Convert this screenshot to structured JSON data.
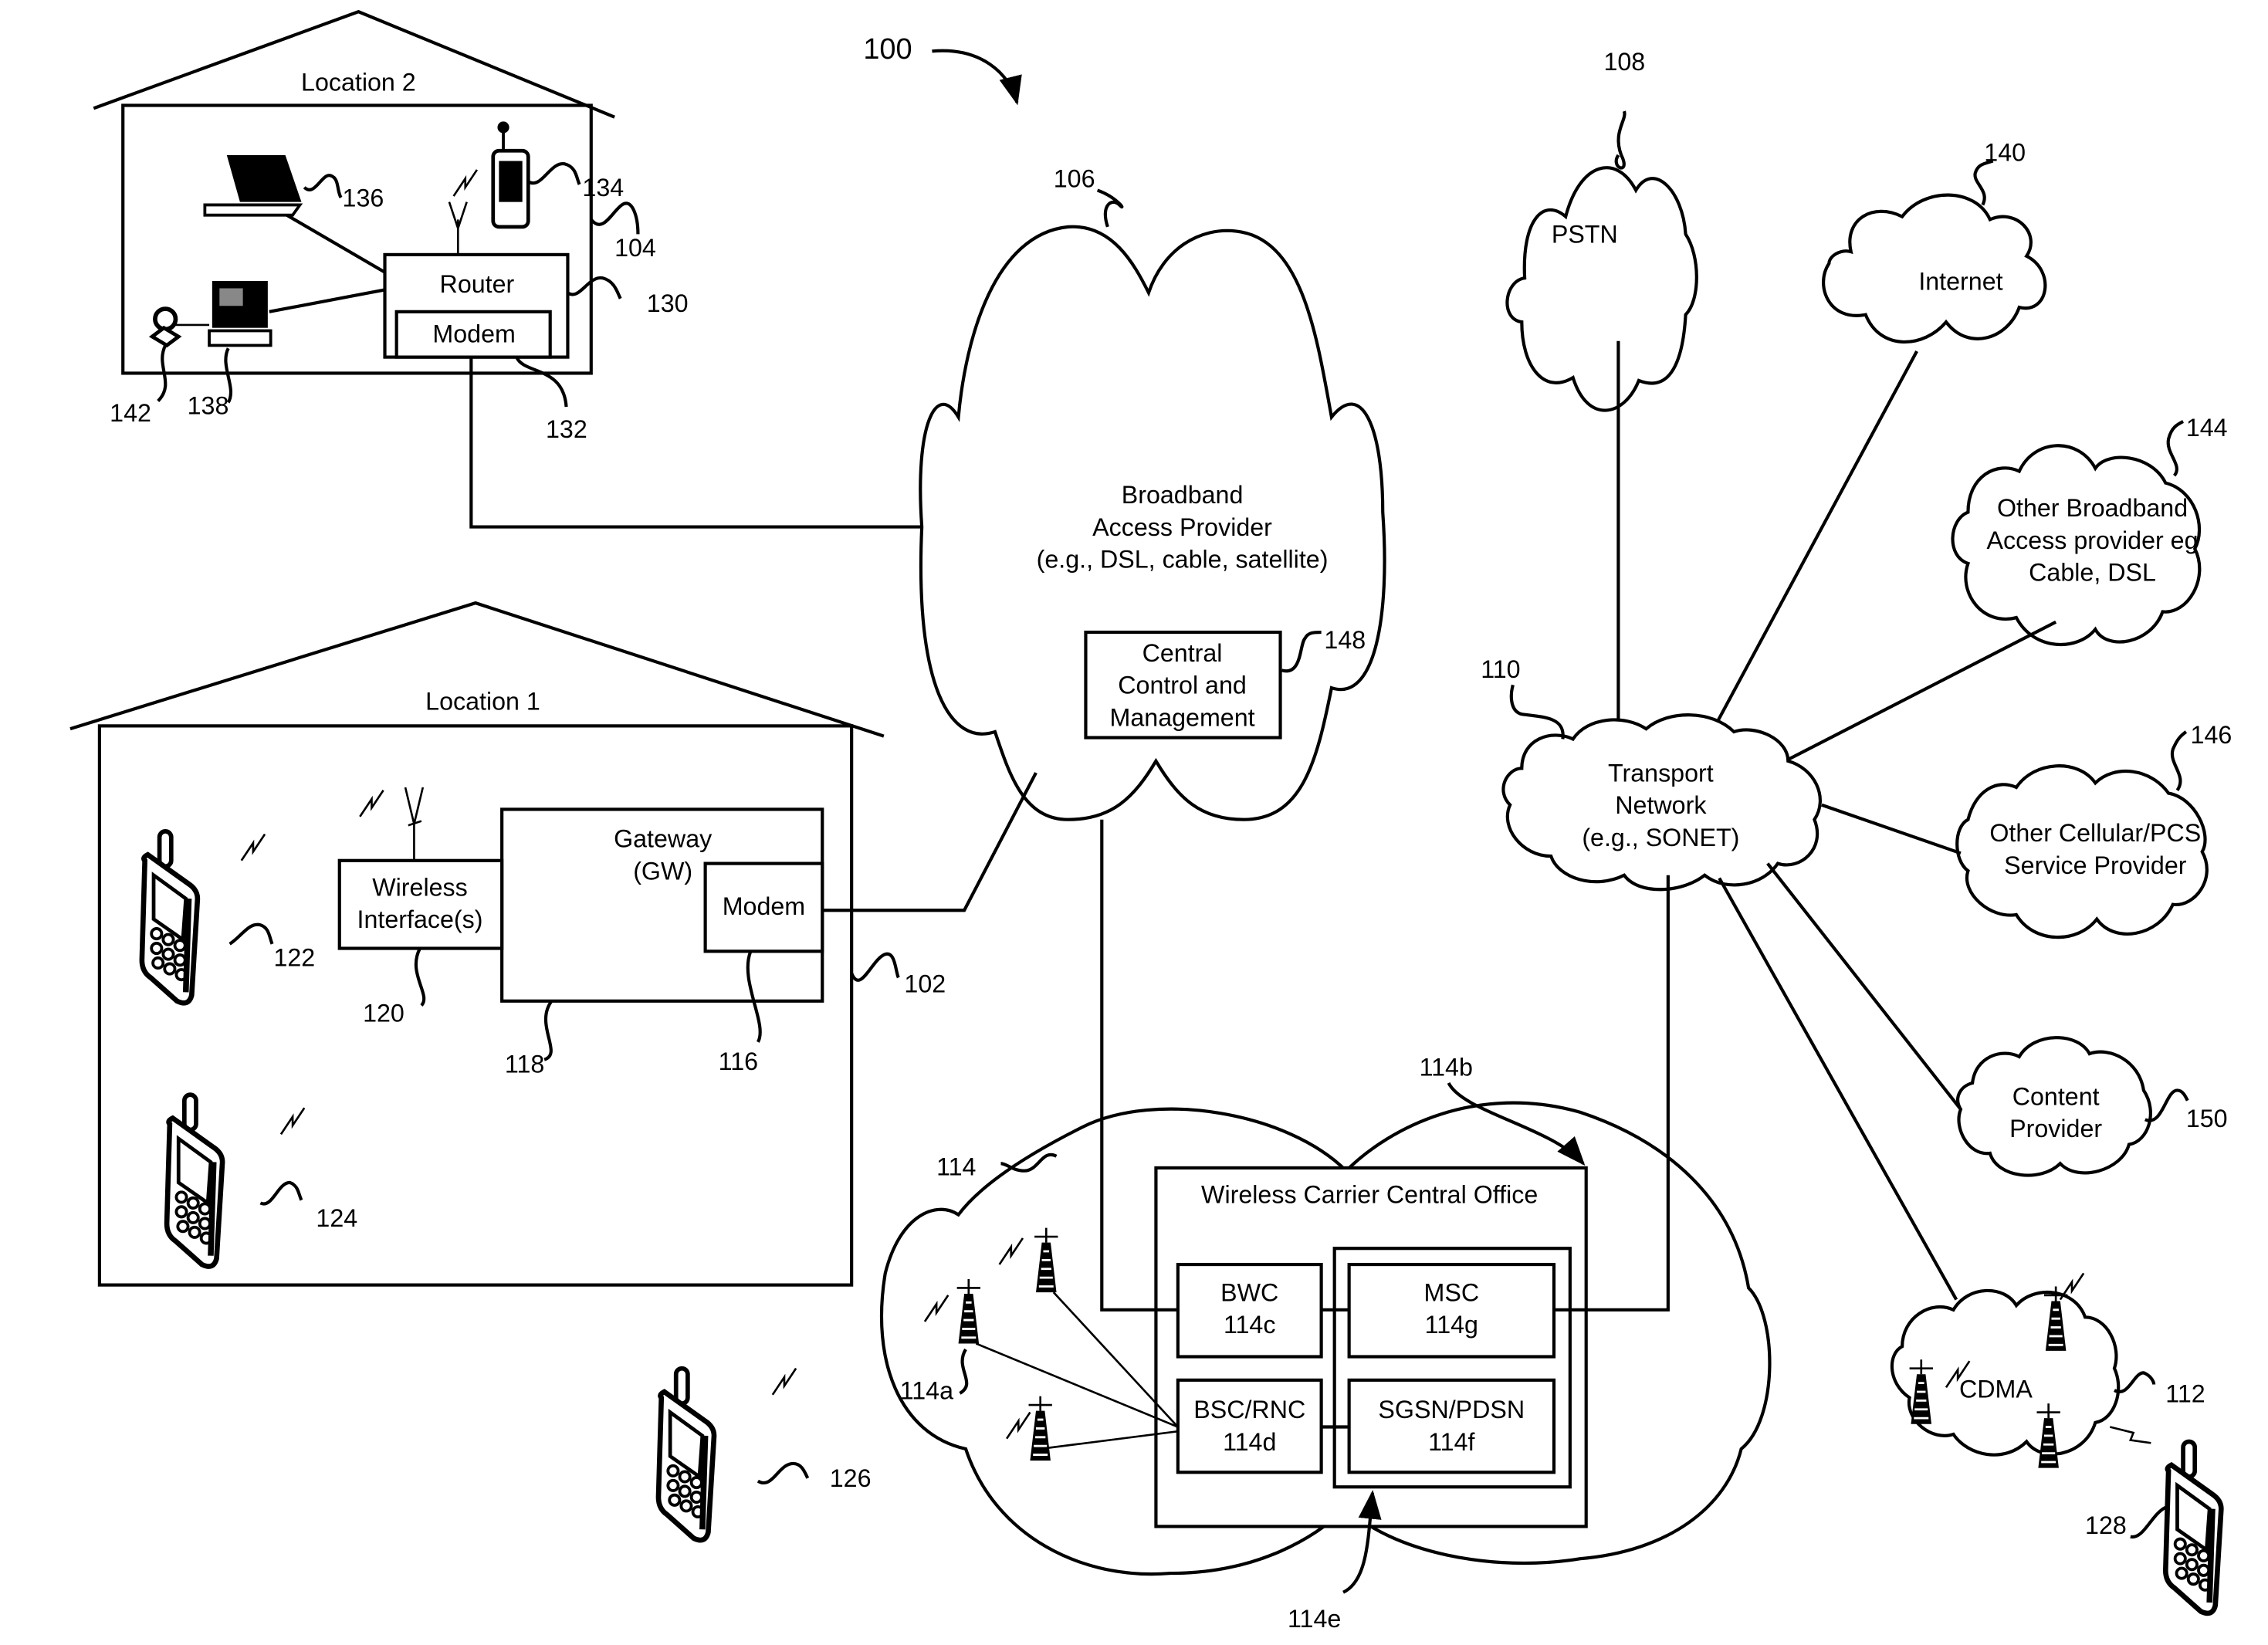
{
  "figure_ref": "100",
  "location2": {
    "title": "Location 2",
    "ref": "104",
    "router": {
      "label": "Router",
      "ref": "130"
    },
    "modem": {
      "label": "Modem",
      "ref": "132"
    },
    "pda_ref": "134",
    "laptop_ref": "136",
    "desktop_ref": "138",
    "webcam_ref": "142"
  },
  "location1": {
    "title": "Location 1",
    "ref": "102",
    "gateway": {
      "line1": "Gateway",
      "line2": "(GW)",
      "ref": "118"
    },
    "modem": {
      "label": "Modem",
      "ref": "116"
    },
    "wireless_interface": {
      "line1": "Wireless",
      "line2": "Interface(s)",
      "ref": "120"
    },
    "phone1_ref": "122",
    "phone2_ref": "124"
  },
  "broadband": {
    "ref": "106",
    "lines": [
      "Broadband",
      "Access Provider",
      "(e.g., DSL, cable, satellite)"
    ],
    "central_control": {
      "lines": [
        "Central",
        "Control and",
        "Management"
      ],
      "ref": "148"
    }
  },
  "pstn": {
    "label": "PSTN",
    "ref": "108"
  },
  "internet": {
    "label": "Internet",
    "ref": "140"
  },
  "transport": {
    "lines": [
      "Transport",
      "Network",
      "(e.g., SONET)"
    ],
    "ref": "110"
  },
  "other_broadband": {
    "lines": [
      "Other Broadband",
      "Access provider eg",
      "Cable, DSL"
    ],
    "ref": "144"
  },
  "other_cellular": {
    "lines": [
      "Other Cellular/PCS",
      "Service Provider"
    ],
    "ref": "146"
  },
  "content_provider": {
    "lines": [
      "Content",
      "Provider"
    ],
    "ref": "150"
  },
  "cdma": {
    "label": "CDMA",
    "ref": "112",
    "phone_ref": "128"
  },
  "wireless_carrier": {
    "cloud_ref": "114",
    "tower_ref": "114a",
    "office": {
      "label": "Wireless Carrier Central Office",
      "ref": "114b"
    },
    "inner_group_ref": "114e",
    "bwc": {
      "line1": "BWC",
      "line2": "114c"
    },
    "bsc": {
      "line1": "BSC/RNC",
      "line2": "114d"
    },
    "msc": {
      "line1": "MSC",
      "line2": "114g"
    },
    "sgsn": {
      "line1": "SGSN/PDSN",
      "line2": "114f"
    }
  },
  "roaming_phone_ref": "126"
}
